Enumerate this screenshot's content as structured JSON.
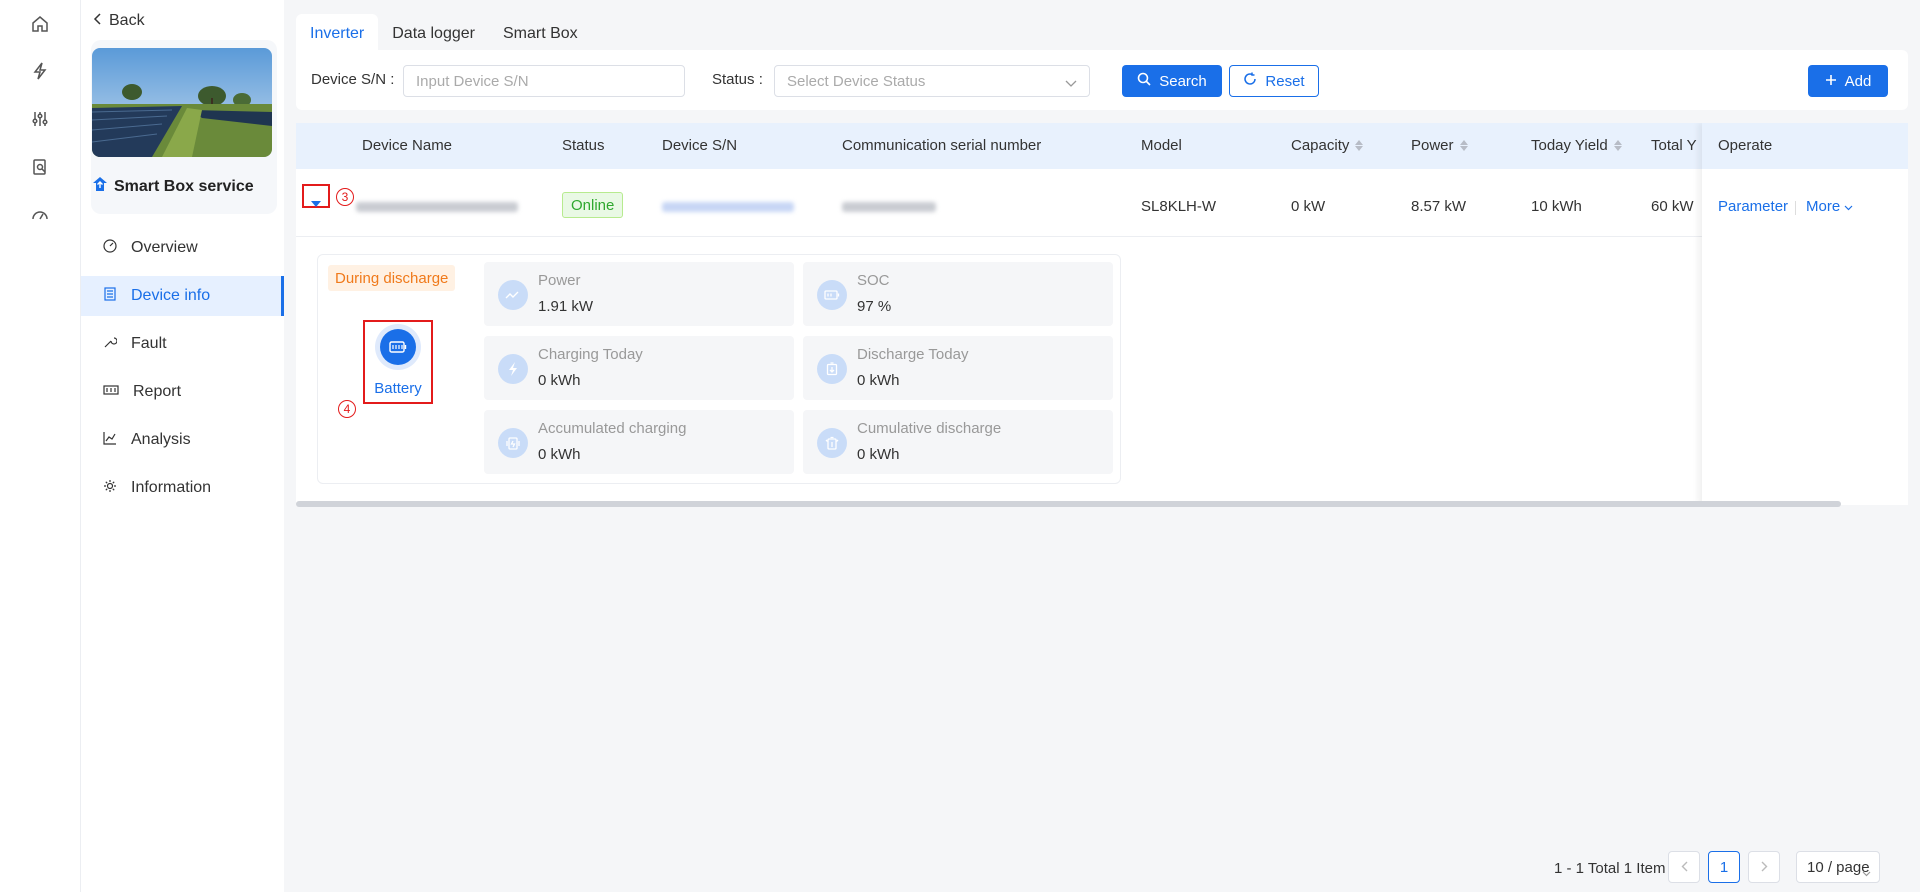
{
  "sidebar_nav": {
    "back_label": "Back",
    "plant_name": "Smart Box service",
    "items": [
      {
        "label": "Overview",
        "icon": "dashboard-icon"
      },
      {
        "label": "Device info",
        "icon": "list-icon",
        "active": true
      },
      {
        "label": "Fault",
        "icon": "wrench-icon"
      },
      {
        "label": "Report",
        "icon": "report-icon"
      },
      {
        "label": "Analysis",
        "icon": "line-chart-icon"
      },
      {
        "label": "Information",
        "icon": "gear-icon"
      }
    ]
  },
  "tabs": [
    {
      "label": "Inverter",
      "active": true
    },
    {
      "label": "Data logger"
    },
    {
      "label": "Smart Box"
    }
  ],
  "filter": {
    "sn_label": "Device S/N :",
    "sn_placeholder": "Input Device S/N",
    "status_label": "Status :",
    "status_placeholder": "Select Device Status",
    "search_label": "Search",
    "reset_label": "Reset",
    "add_label": "Add"
  },
  "table": {
    "headers": {
      "device_name": "Device Name",
      "status": "Status",
      "device_sn": "Device S/N",
      "comm_sn": "Communication serial number",
      "model": "Model",
      "capacity": "Capacity",
      "power": "Power",
      "today_yield": "Today Yield",
      "total_yield": "Total Y",
      "operate": "Operate"
    },
    "row": {
      "status": "Online",
      "model": "SL8KLH-W",
      "capacity": "0 kW",
      "power": "8.57 kW",
      "today_yield": "10 kWh",
      "total_yield": "60 kW",
      "parameter_label": "Parameter",
      "more_label": "More"
    }
  },
  "expanded": {
    "state_tag": "During discharge",
    "battery_label": "Battery",
    "metrics": [
      {
        "label": "Power",
        "value": "1.91 kW"
      },
      {
        "label": "SOC",
        "value": "97 %"
      },
      {
        "label": "Charging Today",
        "value": "0 kWh"
      },
      {
        "label": "Discharge Today",
        "value": "0 kWh"
      },
      {
        "label": "Accumulated charging",
        "value": "0 kWh"
      },
      {
        "label": "Cumulative discharge",
        "value": "0 kWh"
      }
    ]
  },
  "annotations": {
    "expand": "3",
    "battery": "4"
  },
  "pagination": {
    "summary": "1 - 1 Total 1 Item",
    "current_page": "1",
    "page_size": "10 / page"
  },
  "colors": {
    "accent": "#1a6fe8",
    "online": "#2fa82f",
    "discharge": "#f07a1b",
    "annotation": "#e31b1b"
  }
}
